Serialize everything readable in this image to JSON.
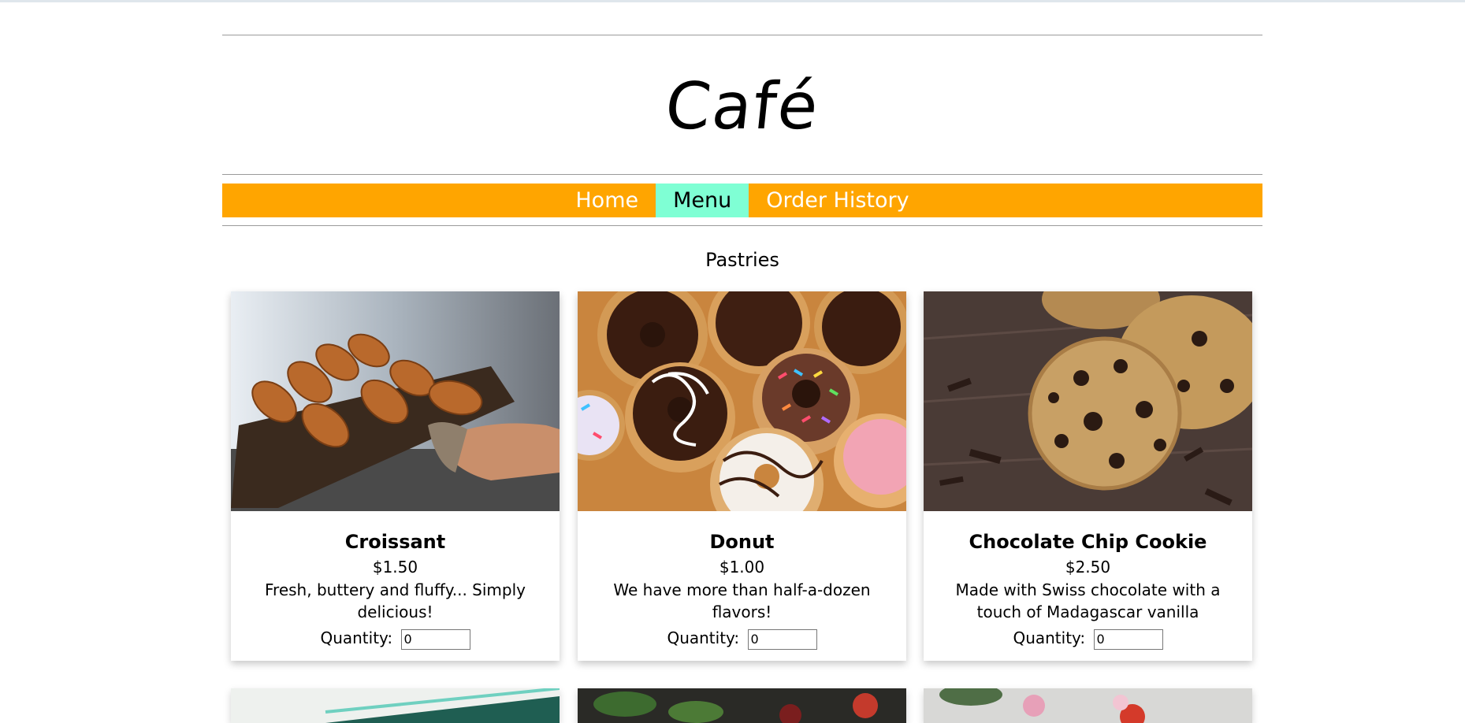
{
  "site": {
    "title": "Café"
  },
  "nav": {
    "items": [
      {
        "label": "Home"
      },
      {
        "label": "Menu"
      },
      {
        "label": "Order History"
      }
    ]
  },
  "section": {
    "title": "Pastries"
  },
  "products": [
    {
      "name": "Croissant",
      "price": "$1.50",
      "description": "Fresh, buttery and fluffy... Simply delicious!",
      "quantity_label": "Quantity:",
      "quantity_value": "0"
    },
    {
      "name": "Donut",
      "price": "$1.00",
      "description": "We have more than half-a-dozen flavors!",
      "quantity_label": "Quantity:",
      "quantity_value": "0"
    },
    {
      "name": "Chocolate Chip Cookie",
      "price": "$2.50",
      "description": "Made with Swiss chocolate with a touch of Madagascar vanilla",
      "quantity_label": "Quantity:",
      "quantity_value": "0"
    }
  ],
  "colors": {
    "nav_bg": "#ffa500",
    "nav_active": "#7fffd4",
    "rule": "#9a9a9a"
  }
}
